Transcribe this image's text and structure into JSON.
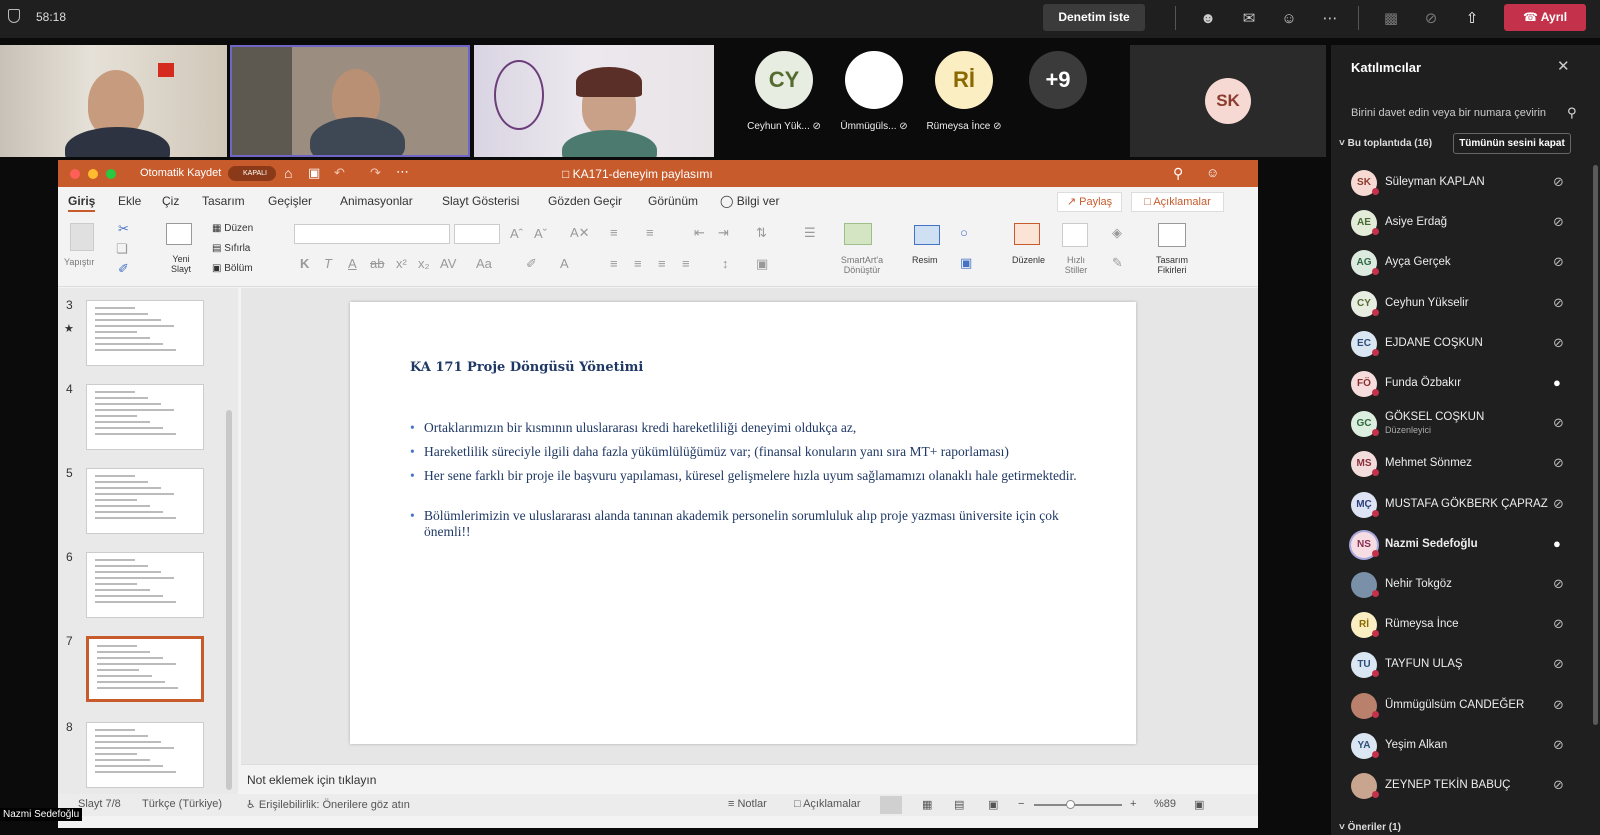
{
  "topbar": {
    "timer": "58:18",
    "request_control": "Denetim iste",
    "leave": "Ayrıl"
  },
  "videos": [
    {
      "name": "video-participant-1"
    },
    {
      "name": "video-participant-2"
    },
    {
      "name": "video-participant-3"
    }
  ],
  "tiles": [
    {
      "initials": "CY",
      "name": "Ceyhun Yük...",
      "color": "#e8ede2",
      "fg": "#556b2f"
    },
    {
      "initials": "",
      "name": "Ümmügüls...",
      "color": "#ffffff",
      "fg": "#000"
    },
    {
      "initials": "Rİ",
      "name": "Rümeysa İnce",
      "color": "#fbeec3",
      "fg": "#8a6a00"
    },
    {
      "initials": "+9",
      "name": "",
      "color": "#3b3b3b",
      "fg": "#ffffff"
    }
  ],
  "sk_tile": {
    "initials": "SK"
  },
  "ppt": {
    "autosave": "Otomatik Kaydet",
    "autosave_state": "KAPALI",
    "doc_title": "KA171-deneyim paylasımı",
    "tabs": [
      "Giriş",
      "Ekle",
      "Çiz",
      "Tasarım",
      "Geçişler",
      "Animasyonlar",
      "Slayt Gösterisi",
      "Gözden Geçir",
      "Görünüm"
    ],
    "tell_me": "Bilgi ver",
    "share": "Paylaş",
    "comments": "Açıklamalar",
    "ribbon": {
      "paste": "Yapıştır",
      "new_slide": "Yeni Slayt",
      "layout": "Düzen",
      "reset": "Sıfırla",
      "section": "Bölüm",
      "smartart": "SmartArt'a Dönüştür",
      "picture": "Resim",
      "arrange": "Düzenle",
      "quick_styles": "Hızlı Stiller",
      "design_ideas": "Tasarım Fikirleri"
    },
    "thumb_numbers": [
      "3",
      "4",
      "5",
      "6",
      "7",
      "8"
    ],
    "slide": {
      "title": "KA 171 Proje Döngüsü Yönetimi",
      "bullets": [
        "Ortaklarımızın bir kısmının uluslararası kredi hareketliliği deneyimi oldukça az,",
        "Hareketlilik süreciyle ilgili daha fazla yükümlülüğümüz var; (finansal konuların yanı sıra MT+ raporlaması)",
        "Her sene farklı bir proje ile başvuru yapılaması, küresel gelişmelere hızla uyum sağlamamızı olanaklı hale getirmektedir.",
        "Bölümlerimizin ve uluslararası alanda tanınan akademik personelin sorumluluk alıp proje yazması üniversite için çok önemli!!"
      ]
    },
    "notes_placeholder": "Not eklemek için tıklayın",
    "status": {
      "slide": "Slayt 7/8",
      "lang": "Türkçe (Türkiye)",
      "accessibility": "Erişilebilirlik: Önerilere göz atın",
      "notes": "Notlar",
      "comments": "Açıklamalar",
      "zoom": "%89"
    }
  },
  "name_tag": "Nazmi Sedefoğlu",
  "panel": {
    "title": "Katılımcılar",
    "invite_placeholder": "Birini davet edin veya bir numara çevirin",
    "in_meeting": "Bu toplantıda (16)",
    "mute_all": "Tümünün sesini kapat",
    "suggestions": "Öneriler (1)",
    "participants": [
      {
        "initials": "SK",
        "name": "Süleyman KAPLAN",
        "sub": "",
        "color": "#f7d9d3",
        "fg": "#8a3d2e",
        "mic": "off"
      },
      {
        "initials": "AE",
        "name": "Asiye Erdağ",
        "sub": "",
        "color": "#e2ecd9",
        "fg": "#4a6b2f",
        "mic": "off"
      },
      {
        "initials": "AG",
        "name": "Ayça Gerçek",
        "sub": "",
        "color": "#dceadf",
        "fg": "#2f6b45",
        "mic": "off"
      },
      {
        "initials": "CY",
        "name": "Ceyhun Yükselir",
        "sub": "",
        "color": "#e8ede2",
        "fg": "#556b2f",
        "mic": "off"
      },
      {
        "initials": "EC",
        "name": "EJDANE COŞKUN",
        "sub": "",
        "color": "#dbe6f3",
        "fg": "#2f4f7a",
        "mic": "off"
      },
      {
        "initials": "FÖ",
        "name": "Funda Özbakır",
        "sub": "",
        "color": "#f6dcdc",
        "fg": "#8a2f2f",
        "mic": "on"
      },
      {
        "initials": "GC",
        "name": "GÖKSEL COŞKUN",
        "sub": "Düzenleyici",
        "color": "#dceee0",
        "fg": "#2f6b3d",
        "mic": "off"
      },
      {
        "initials": "MS",
        "name": "Mehmet Sönmez",
        "sub": "",
        "color": "#f3dcdc",
        "fg": "#8a2f3d",
        "mic": "off"
      },
      {
        "initials": "MÇ",
        "name": "MUSTAFA GÖKBERK ÇAPRAZ",
        "sub": "",
        "color": "#dde3f3",
        "fg": "#2f3f7a",
        "mic": "off"
      },
      {
        "initials": "NS",
        "name": "Nazmi Sedefoğlu",
        "sub": "",
        "color": "#f6dce3",
        "fg": "#8a2f4f",
        "mic": "on"
      },
      {
        "initials": "",
        "name": "Nehir Tokgöz",
        "sub": "",
        "color": "#7a8fa8",
        "fg": "#fff",
        "mic": "off"
      },
      {
        "initials": "Rİ",
        "name": "Rümeysa İnce",
        "sub": "",
        "color": "#fbeec3",
        "fg": "#8a6a00",
        "mic": "off"
      },
      {
        "initials": "TU",
        "name": "TAYFUN ULAŞ",
        "sub": "",
        "color": "#dbe6f3",
        "fg": "#2f4f7a",
        "mic": "off"
      },
      {
        "initials": "",
        "name": "Ümmügülsüm CANDEĞER",
        "sub": "",
        "color": "#b9806c",
        "fg": "#fff",
        "mic": "off"
      },
      {
        "initials": "YA",
        "name": "Yeşim Alkan",
        "sub": "",
        "color": "#dbe6f3",
        "fg": "#2f4f7a",
        "mic": "off"
      },
      {
        "initials": "",
        "name": "ZEYNEP TEKİN BABUÇ",
        "sub": "",
        "color": "#c9a58f",
        "fg": "#fff",
        "mic": "off"
      }
    ]
  }
}
